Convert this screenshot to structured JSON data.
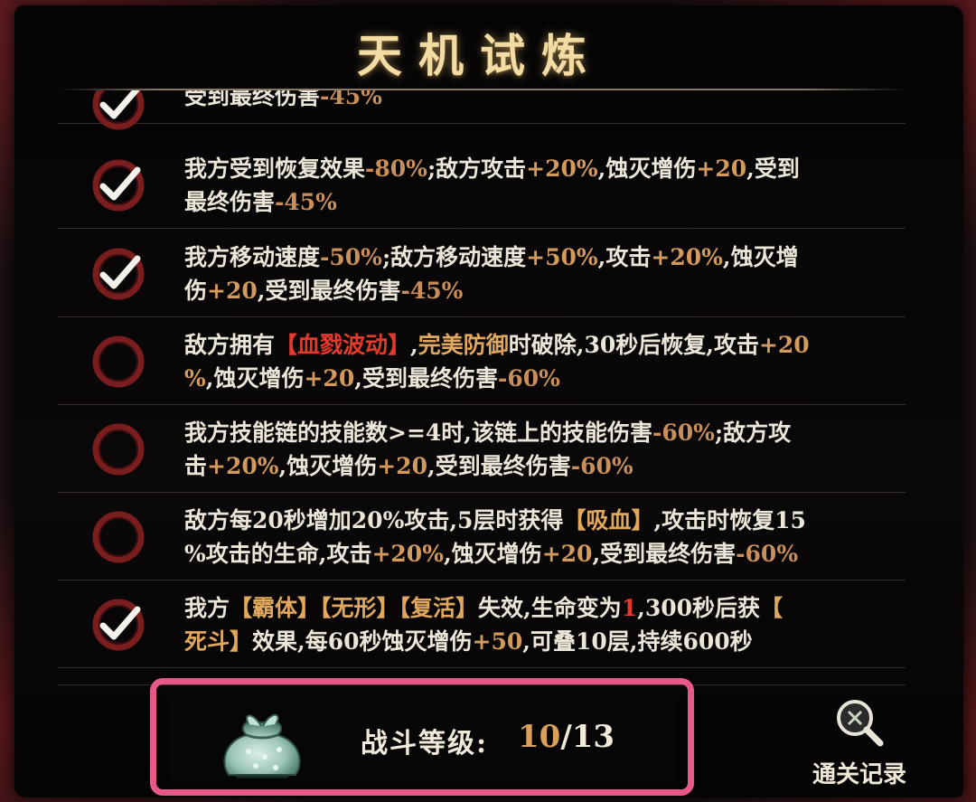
{
  "title": "天机试炼",
  "rows": [
    {
      "checked": true,
      "lines": [
        [
          {
            "t": "受到最终伤害",
            "c": ""
          },
          {
            "t": "-45%",
            "c": "neg"
          }
        ]
      ]
    },
    {
      "checked": true,
      "lines": [
        [
          {
            "t": "我方受到恢复效果",
            "c": ""
          },
          {
            "t": "-80%",
            "c": "neg"
          },
          {
            "t": ";敌方攻击",
            "c": ""
          },
          {
            "t": "+20%",
            "c": "pos"
          },
          {
            "t": ",蚀灭增伤",
            "c": ""
          },
          {
            "t": "+20",
            "c": "pos"
          },
          {
            "t": ",受到",
            "c": ""
          }
        ],
        [
          {
            "t": "最终伤害",
            "c": ""
          },
          {
            "t": "-45%",
            "c": "neg"
          }
        ]
      ]
    },
    {
      "checked": true,
      "lines": [
        [
          {
            "t": "我方移动速度",
            "c": ""
          },
          {
            "t": "-50%",
            "c": "neg"
          },
          {
            "t": ";敌方移动速度",
            "c": ""
          },
          {
            "t": "+50%",
            "c": "pos"
          },
          {
            "t": ",攻击",
            "c": ""
          },
          {
            "t": "+20%",
            "c": "pos"
          },
          {
            "t": ",蚀灭增",
            "c": ""
          }
        ],
        [
          {
            "t": "伤",
            "c": ""
          },
          {
            "t": "+20",
            "c": "pos"
          },
          {
            "t": ",受到最终伤害",
            "c": ""
          },
          {
            "t": "-45%",
            "c": "neg"
          }
        ]
      ]
    },
    {
      "checked": false,
      "lines": [
        [
          {
            "t": "敌方拥有",
            "c": ""
          },
          {
            "t": "【血戮波动】",
            "c": "red"
          },
          {
            "t": ",",
            "c": ""
          },
          {
            "t": "完美防御",
            "c": "tag"
          },
          {
            "t": "时破除,30秒后恢复,攻击",
            "c": ""
          },
          {
            "t": "+20",
            "c": "pos"
          }
        ],
        [
          {
            "t": "%",
            "c": "pos"
          },
          {
            "t": ",蚀灭增伤",
            "c": ""
          },
          {
            "t": "+20",
            "c": "pos"
          },
          {
            "t": ",受到最终伤害",
            "c": ""
          },
          {
            "t": "-60%",
            "c": "neg"
          }
        ]
      ]
    },
    {
      "checked": false,
      "lines": [
        [
          {
            "t": "我方技能链的技能数>=4时,该链上的技能伤害",
            "c": ""
          },
          {
            "t": "-60%",
            "c": "neg"
          },
          {
            "t": ";敌方攻",
            "c": ""
          }
        ],
        [
          {
            "t": "击",
            "c": ""
          },
          {
            "t": "+20%",
            "c": "pos"
          },
          {
            "t": ",蚀灭增伤",
            "c": ""
          },
          {
            "t": "+20",
            "c": "pos"
          },
          {
            "t": ",受到最终伤害",
            "c": ""
          },
          {
            "t": "-60%",
            "c": "neg"
          }
        ]
      ]
    },
    {
      "checked": false,
      "lines": [
        [
          {
            "t": "敌方每20秒增加20%攻击,5层时获得",
            "c": ""
          },
          {
            "t": "【吸血】",
            "c": "tag"
          },
          {
            "t": ",攻击时恢复15",
            "c": ""
          }
        ],
        [
          {
            "t": "%攻击的生命,攻击",
            "c": ""
          },
          {
            "t": "+20%",
            "c": "pos"
          },
          {
            "t": ",蚀灭增伤",
            "c": ""
          },
          {
            "t": "+20",
            "c": "pos"
          },
          {
            "t": ",受到最终伤害",
            "c": ""
          },
          {
            "t": "-60%",
            "c": "neg"
          }
        ]
      ]
    },
    {
      "checked": true,
      "lines": [
        [
          {
            "t": "我方",
            "c": ""
          },
          {
            "t": "【霸体】【无形】【复活】",
            "c": "tag"
          },
          {
            "t": "失效,生命变为",
            "c": ""
          },
          {
            "t": "1",
            "c": "red"
          },
          {
            "t": ",300秒后获",
            "c": ""
          },
          {
            "t": "【",
            "c": "tag"
          }
        ],
        [
          {
            "t": "死斗】",
            "c": "tag"
          },
          {
            "t": "效果,每60秒蚀灭增伤",
            "c": ""
          },
          {
            "t": "+50",
            "c": "pos"
          },
          {
            "t": ",可叠10层,持续600秒",
            "c": ""
          }
        ]
      ]
    }
  ],
  "battle_level": {
    "label": "战斗等级:",
    "current": "10",
    "max": "/13"
  },
  "record_label": "通关记录",
  "icons": {
    "check": "check-ring-icon",
    "empty": "empty-ring-icon",
    "bag": "cloth-bag-icon",
    "search": "magnifier-icon"
  }
}
